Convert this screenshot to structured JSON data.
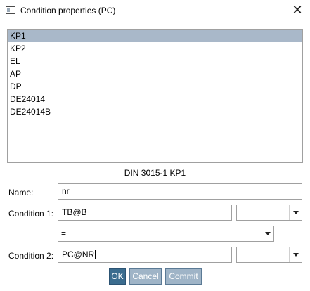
{
  "window": {
    "title": "Condition properties (PC)",
    "close_glyph": "✕",
    "icon": "window-icon",
    "close_icon": "close-icon"
  },
  "list": {
    "items": [
      "KP1",
      "KP2",
      "EL",
      "AP",
      "DP",
      "DE24014",
      "DE24014B"
    ],
    "selected_index": 0
  },
  "caption": "DIN 3015-1 KP1",
  "name": {
    "label": "Name:",
    "value": "nr"
  },
  "condition1": {
    "label": "Condition 1:",
    "value": "TB@B",
    "combo_value": ""
  },
  "operator": {
    "value": "="
  },
  "condition2": {
    "label": "Condition 2:",
    "value": "PC@NR",
    "combo_value": ""
  },
  "buttons": {
    "ok": "OK",
    "cancel": "Cancel",
    "commit": "Commit"
  },
  "colors": {
    "selection": "#a9b8c9",
    "primary_button": "#3b6c8e",
    "disabled_button": "#9fb4c7"
  }
}
